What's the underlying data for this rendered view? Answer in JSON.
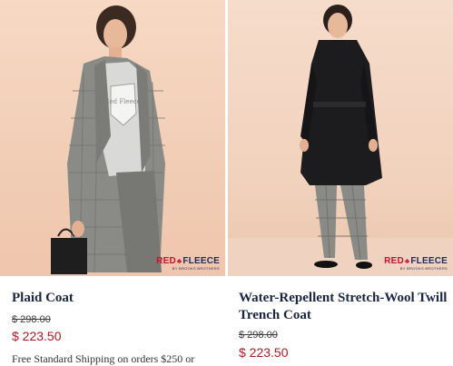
{
  "products": [
    {
      "name": "Plaid Coat",
      "original_price": "$ 298.00",
      "sale_price": "$ 223.50",
      "promo": "Free Standard Shipping on orders $250 or",
      "logo": {
        "word1": "RED",
        "word2": "FLEECE",
        "sub": "BY BROOKS BROTHERS"
      },
      "shirt_text": "Red Fleece"
    },
    {
      "name": "Water-Repellent Stretch-Wool Twill Trench Coat",
      "original_price": "$ 298.00",
      "sale_price": "$ 223.50",
      "logo": {
        "word1": "RED",
        "word2": "FLEECE",
        "sub": "BY BROOKS BROTHERS"
      }
    }
  ],
  "colors": {
    "title": "#1a2544",
    "sale": "#b0191f",
    "logo_red": "#c8102e",
    "logo_navy": "#1f2a5a"
  }
}
